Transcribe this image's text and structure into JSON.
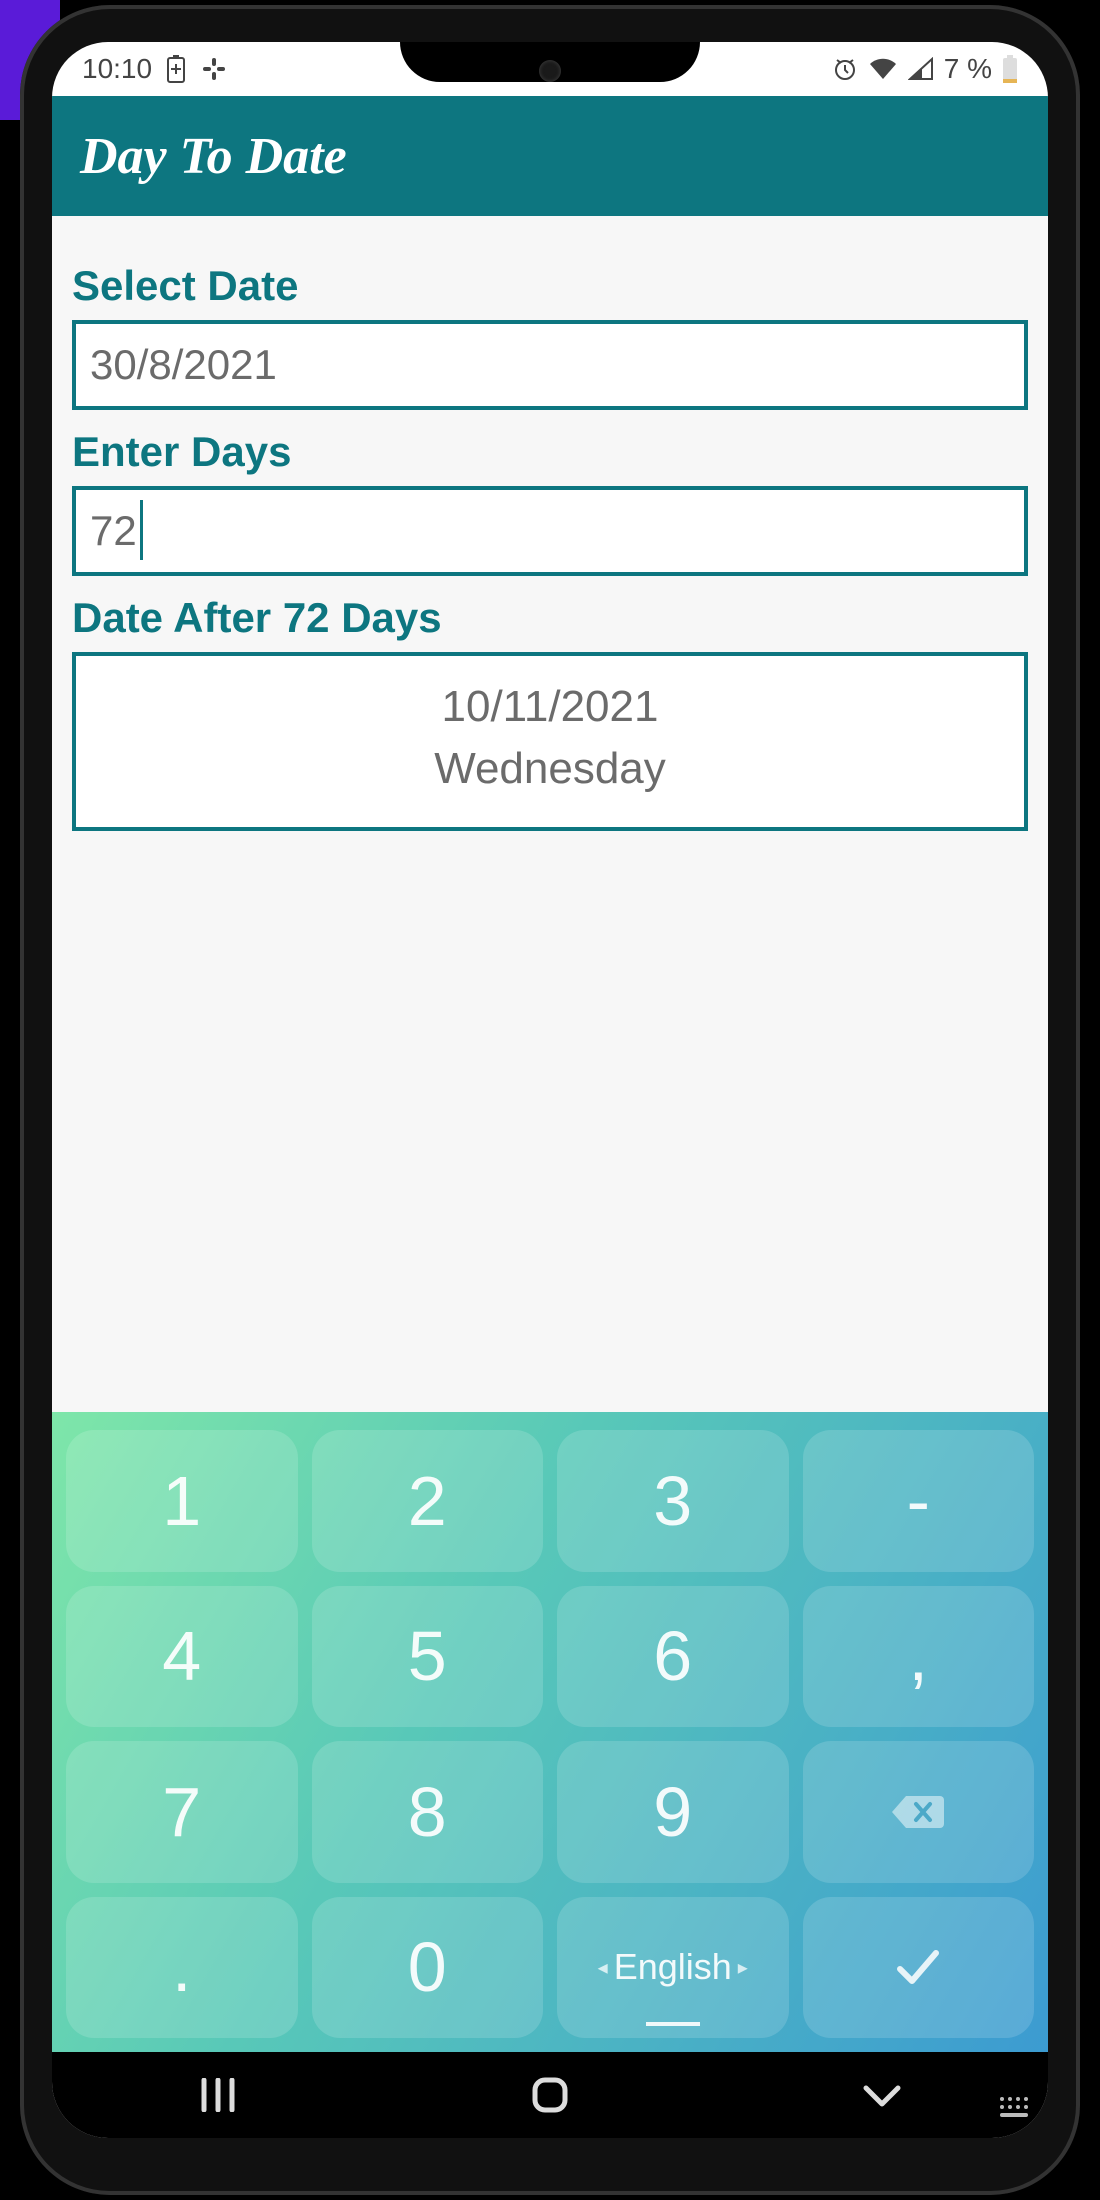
{
  "status": {
    "time": "10:10",
    "battery_text": "7 %"
  },
  "app": {
    "title": "Day To Date"
  },
  "form": {
    "select_date_label": "Select Date",
    "select_date_value": "30/8/2021",
    "enter_days_label": "Enter Days",
    "enter_days_value": "72",
    "result_label": "Date After 72 Days",
    "result_date": "10/11/2021",
    "result_day": "Wednesday"
  },
  "keyboard": {
    "rows": [
      [
        "1",
        "2",
        "3",
        "-"
      ],
      [
        "4",
        "5",
        "6",
        ","
      ],
      [
        "7",
        "8",
        "9",
        "⌫"
      ],
      [
        ".",
        "0",
        "English",
        "✓"
      ]
    ],
    "language": "English"
  }
}
